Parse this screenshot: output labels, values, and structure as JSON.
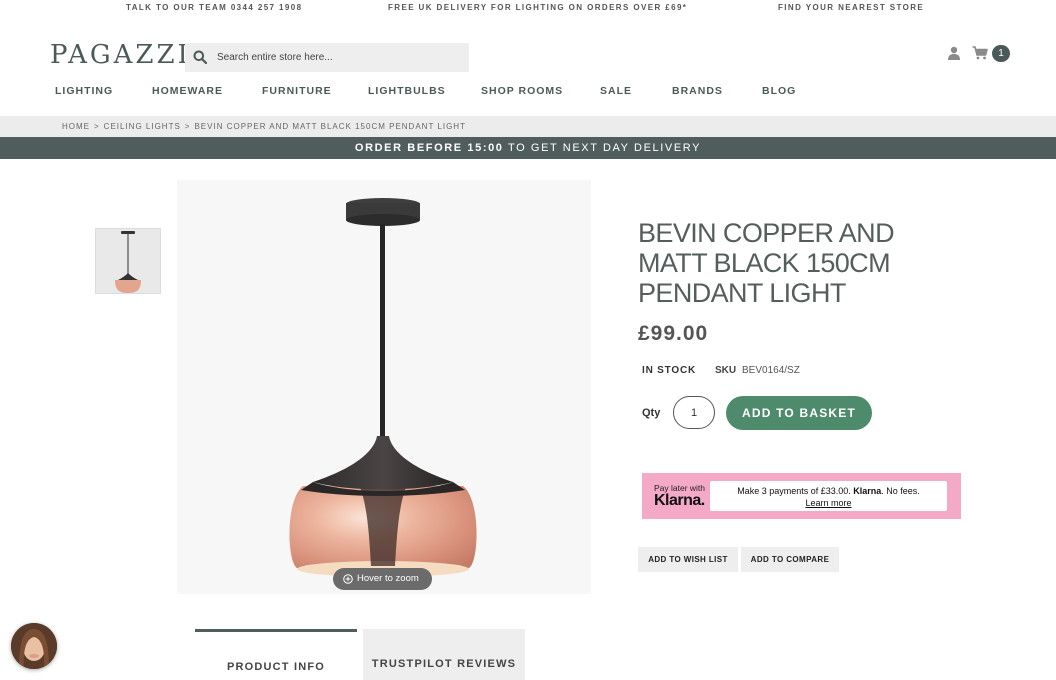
{
  "topbar": {
    "phone_text": "TALK TO OUR TEAM 0344 257 1908",
    "delivery_text": "FREE UK DELIVERY FOR LIGHTING ON ORDERS OVER £69*",
    "store_text": "FIND YOUR NEAREST STORE"
  },
  "header": {
    "logo": "PAGAZZI",
    "search_placeholder": "Search entire store here...",
    "cart_count": "1"
  },
  "nav": [
    "LIGHTING",
    "HOMEWARE",
    "FURNITURE",
    "LIGHTBULBS",
    "SHOP ROOMS",
    "SALE",
    "BRANDS",
    "BLOG"
  ],
  "breadcrumb": {
    "home": "HOME",
    "category": "CEILING LIGHTS",
    "current": "BEVIN COPPER AND MATT BLACK 150CM PENDANT LIGHT",
    "separator": ">"
  },
  "banner": {
    "bold": "ORDER BEFORE 15:00",
    "rest": " TO GET NEXT DAY DELIVERY"
  },
  "gallery": {
    "zoom_label": "Hover to zoom"
  },
  "product": {
    "title": "BEVIN COPPER AND MATT BLACK 150CM PENDANT LIGHT",
    "price": "£99.00",
    "stock": "IN STOCK",
    "sku_label": "SKU",
    "sku_value": "BEV0164/SZ",
    "qty_label": "Qty",
    "qty_value": "1",
    "add_to_basket": "ADD TO BASKET",
    "wish_list": "ADD TO WISH LIST",
    "compare": "ADD TO COMPARE"
  },
  "klarna": {
    "pay_later": "Pay later with",
    "brand": "Klarna.",
    "message_pre": "Make 3 payments of £33.00. ",
    "message_brand": "Klarna",
    "message_post": ". No fees.",
    "learn_more": "Learn more"
  },
  "tabs": [
    "PRODUCT INFO",
    "TRUSTPILOT REVIEWS"
  ],
  "colors": {
    "brand": "#4f5e5c",
    "basket_button": "#4e8a6c",
    "klarna_pink": "#f4a9c6",
    "copper": "#e9b29c"
  }
}
